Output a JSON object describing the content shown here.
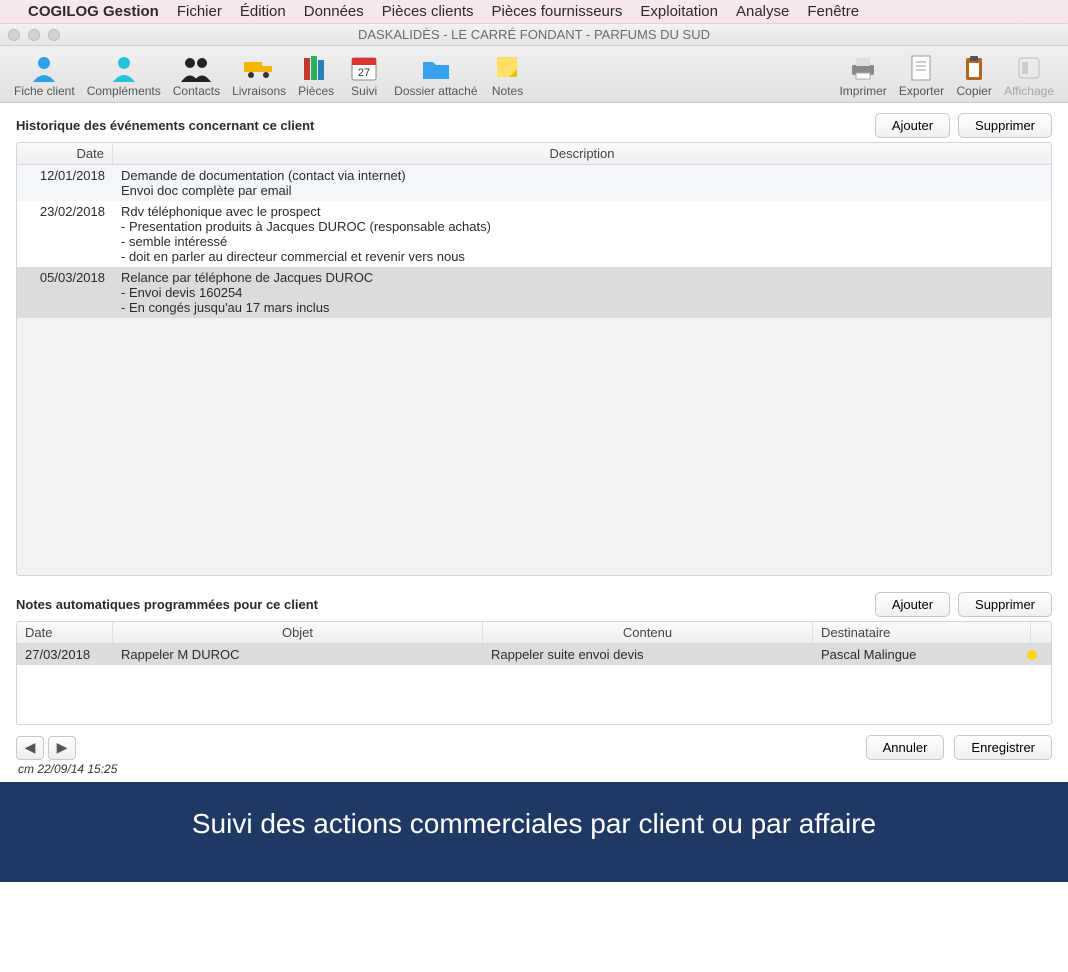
{
  "menubar": {
    "app_name": "COGILOG Gestion",
    "items": [
      "Fichier",
      "Édition",
      "Données",
      "Pièces clients",
      "Pièces fournisseurs",
      "Exploitation",
      "Analyse",
      "Fenêtre"
    ]
  },
  "window": {
    "title": "DASKALIDÈS - LE CARRÉ FONDANT - PARFUMS DU SUD"
  },
  "toolbar": {
    "left": [
      {
        "name": "fiche-client",
        "label": "Fiche client",
        "icon": "person-blue"
      },
      {
        "name": "complements",
        "label": "Compléments",
        "icon": "person-cyan"
      },
      {
        "name": "contacts",
        "label": "Contacts",
        "icon": "people-black"
      },
      {
        "name": "livraisons",
        "label": "Livraisons",
        "icon": "truck-yellow"
      },
      {
        "name": "pieces",
        "label": "Pièces",
        "icon": "books"
      },
      {
        "name": "suivi",
        "label": "Suivi",
        "icon": "calendar"
      },
      {
        "name": "dossier-attache",
        "label": "Dossier attaché",
        "icon": "folder-blue"
      },
      {
        "name": "notes",
        "label": "Notes",
        "icon": "sticky-yellow"
      }
    ],
    "right": [
      {
        "name": "imprimer",
        "label": "Imprimer",
        "icon": "printer"
      },
      {
        "name": "exporter",
        "label": "Exporter",
        "icon": "document"
      },
      {
        "name": "copier",
        "label": "Copier",
        "icon": "clipboard"
      },
      {
        "name": "affichage",
        "label": "Affichage",
        "icon": "switch",
        "disabled": true
      }
    ]
  },
  "events_section": {
    "title": "Historique des événements concernant ce client",
    "add_label": "Ajouter",
    "delete_label": "Supprimer",
    "columns": {
      "date": "Date",
      "description": "Description"
    },
    "rows": [
      {
        "date": "12/01/2018",
        "description": "Demande de documentation (contact via internet)\nEnvoi doc complète par email",
        "sel": false,
        "alt": "blue"
      },
      {
        "date": "23/02/2018",
        "description": "Rdv téléphonique avec le prospect\n- Presentation produits à Jacques DUROC (responsable achats)\n- semble intéressé\n- doit en parler au directeur commercial et revenir vers nous",
        "sel": false,
        "alt": "white"
      },
      {
        "date": "05/03/2018",
        "description": "Relance par téléphone de Jacques DUROC\n- Envoi devis 160254\n- En congés jusqu'au 17 mars inclus",
        "sel": true,
        "alt": "sel"
      }
    ]
  },
  "notes_section": {
    "title": "Notes automatiques programmées pour ce client",
    "add_label": "Ajouter",
    "delete_label": "Supprimer",
    "columns": {
      "date": "Date",
      "objet": "Objet",
      "contenu": "Contenu",
      "destinataire": "Destinataire"
    },
    "rows": [
      {
        "date": "27/03/2018",
        "objet": "Rappeler M DUROC",
        "contenu": "Rappeler suite envoi devis",
        "destinataire": "Pascal Malingue",
        "sel": true
      }
    ]
  },
  "footer": {
    "cancel_label": "Annuler",
    "save_label": "Enregistrer",
    "timestamp": "cm 22/09/14 15:25"
  },
  "caption": "Suivi des actions commerciales par client ou par affaire"
}
